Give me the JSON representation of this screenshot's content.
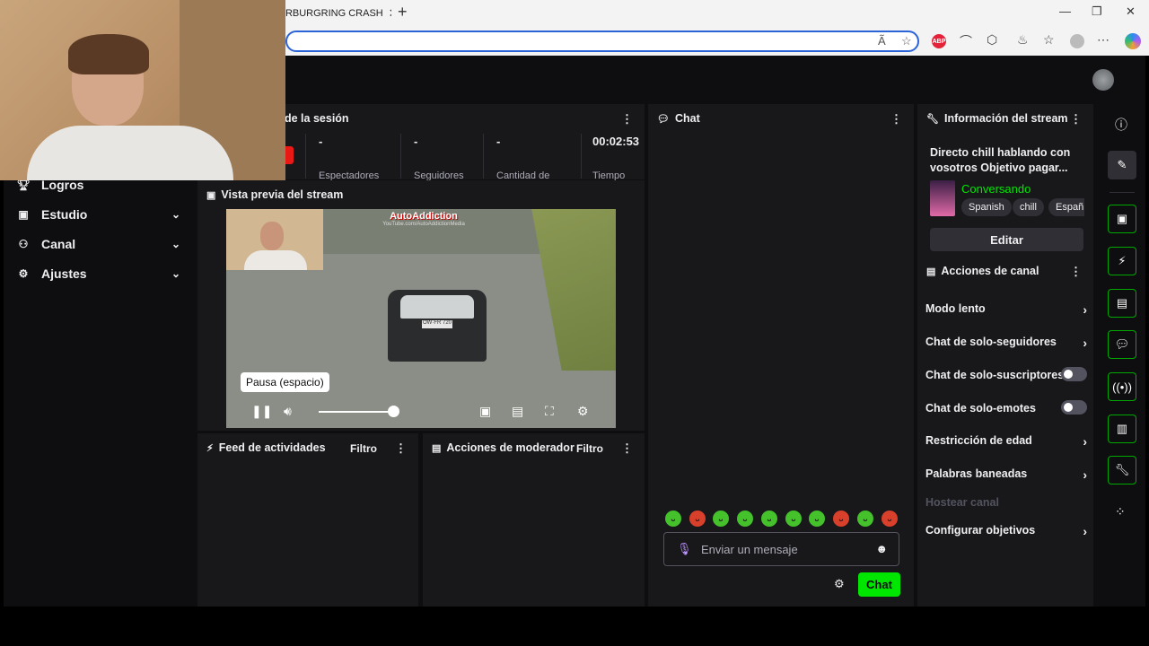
{
  "browser": {
    "tab_title": "URBURGRING CRASH",
    "tab_close": "✕",
    "new_tab": "+",
    "window_controls": [
      "—",
      "❐",
      "✕"
    ],
    "extensions": [
      "ABP"
    ]
  },
  "sidebar": {
    "items": [
      {
        "label": "Logros",
        "icon": "trophy-icon",
        "chevron": false
      },
      {
        "label": "Estudio",
        "icon": "studio-icon",
        "chevron": true
      },
      {
        "label": "Canal",
        "icon": "channel-icon",
        "chevron": true
      },
      {
        "label": "Ajustes",
        "icon": "gear-icon",
        "chevron": true
      }
    ]
  },
  "session": {
    "title": "de la sesión",
    "stats": [
      {
        "value": "-",
        "label": "Espectadores"
      },
      {
        "value": "-",
        "label": "Seguidores"
      },
      {
        "value": "-",
        "label": "Cantidad de"
      },
      {
        "value": "00:02:53",
        "label": "Tiempo"
      }
    ]
  },
  "preview": {
    "title": "Vista previa del stream",
    "video_logo": "AutoAddiction",
    "video_logo_sub": "YouTube.com/AutoAddictionMedia",
    "plate": "OW·FR 720",
    "tooltip": "Pausa (espacio)",
    "volume_level": 0.9
  },
  "feed": {
    "title": "Feed de actividades",
    "filter": "Filtro"
  },
  "modactions": {
    "title": "Acciones de moderador",
    "filter": "Filtro"
  },
  "chat": {
    "title": "Chat",
    "placeholder": "Enviar un mensaje",
    "send_label": "Chat",
    "emotes": [
      "green",
      "red",
      "green",
      "green",
      "green",
      "green",
      "green",
      "red",
      "green",
      "red"
    ]
  },
  "stream_info": {
    "header": "Información del stream",
    "title": "Directo chill hablando con vosotros Objetivo pagar...",
    "category": "Conversando",
    "tags": [
      "Spanish",
      "chill",
      "Españ"
    ],
    "edit_label": "Editar"
  },
  "channel_actions": {
    "header": "Acciones de canal",
    "items": [
      {
        "label": "Modo lento",
        "control": "arrow",
        "enabled": true
      },
      {
        "label": "Chat de solo-seguidores",
        "control": "arrow",
        "enabled": true
      },
      {
        "label": "Chat de solo-suscriptores",
        "control": "toggle",
        "enabled": true,
        "on": false
      },
      {
        "label": "Chat de solo-emotes",
        "control": "toggle",
        "enabled": true,
        "on": false
      },
      {
        "label": "Restricción de edad",
        "control": "arrow",
        "enabled": true
      },
      {
        "label": "Palabras baneadas",
        "control": "arrow",
        "enabled": true
      },
      {
        "label": "Hostear canal",
        "control": "none",
        "enabled": false
      },
      {
        "label": "Configurar objetivos",
        "control": "arrow",
        "enabled": true
      }
    ]
  },
  "colors": {
    "accent": "#00e600",
    "background": "#0e0e10",
    "panel": "#18181b",
    "live_red": "#e91916"
  }
}
